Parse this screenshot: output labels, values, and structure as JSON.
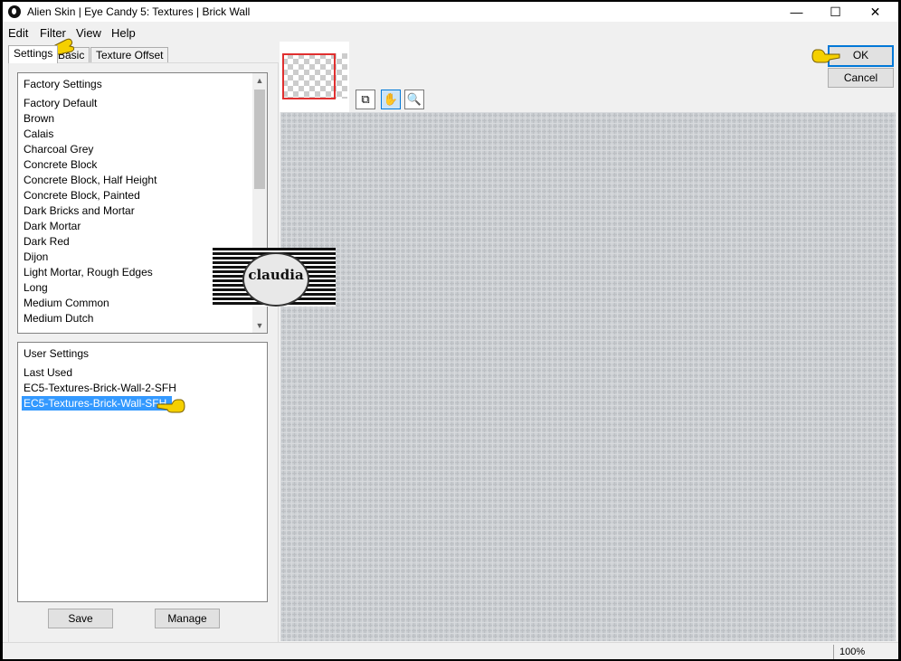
{
  "window": {
    "title": "Alien Skin | Eye Candy 5: Textures | Brick Wall",
    "minimize_label": "—",
    "maximize_label": "☐",
    "close_label": "✕"
  },
  "menu": {
    "items": [
      {
        "label": "Edit"
      },
      {
        "label": "Filter"
      },
      {
        "label": "View"
      },
      {
        "label": "Help"
      }
    ]
  },
  "tabs": [
    {
      "label": "Settings"
    },
    {
      "label": "Basic"
    },
    {
      "label": "Texture Offset"
    }
  ],
  "factory_settings": {
    "header": "Factory Settings",
    "items": [
      "Factory Default",
      "Brown",
      "Calais",
      "Charcoal Grey",
      "Concrete Block",
      "Concrete Block, Half Height",
      "Concrete Block, Painted",
      "Dark Bricks and Mortar",
      "Dark Mortar",
      "Dark Red",
      "Dijon",
      "Light Mortar, Rough Edges",
      "Long",
      "Medium Common",
      "Medium Dutch"
    ]
  },
  "user_settings": {
    "header": "User Settings",
    "items": [
      "Last Used",
      "EC5-Textures-Brick-Wall-2-SFH",
      "EC5-Textures-Brick-Wall-SFH"
    ],
    "selected": "EC5-Textures-Brick-Wall-SFH"
  },
  "buttons": {
    "save": "Save",
    "manage": "Manage",
    "ok": "OK",
    "cancel": "Cancel"
  },
  "toolbar": {
    "tools": [
      {
        "icon": "preview-toggle-icon"
      },
      {
        "icon": "hand-pan-icon"
      },
      {
        "icon": "zoom-magnifier-icon"
      }
    ]
  },
  "watermark": {
    "text": "claudia"
  },
  "statusbar": {
    "zoom": "100%"
  },
  "colors": {
    "selection": "#3399ff",
    "default_button_border": "#0078d7",
    "pointer_hand": "#f5d000",
    "thumbnail_frame": "#e03030"
  }
}
